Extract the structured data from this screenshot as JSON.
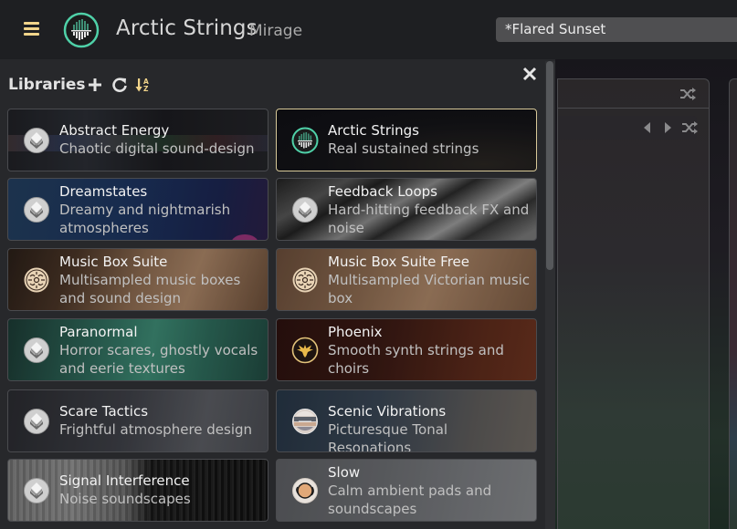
{
  "header": {
    "app_title": "Arctic Strings",
    "app_subtitle": "Mirage",
    "preset_name": "*Flared Sunset",
    "menu_icon": "hamburger-menu-icon",
    "logo_icon": "arctic-strings-logo-icon",
    "accent_color": "#f1d48a"
  },
  "libraries_panel": {
    "title": "Libraries",
    "add_icon": "plus-icon",
    "refresh_icon": "refresh-icon",
    "sort_icon": "sort-az-icon",
    "close_icon": "close-icon",
    "selected_border_color": "#d8c999",
    "items": [
      {
        "name": "Abstract Energy",
        "description": "Chaotic digital sound-design",
        "icon": "diamond-logo-icon",
        "selected": false
      },
      {
        "name": "Arctic Strings",
        "description": "Real sustained strings",
        "icon": "arctic-strings-logo-icon",
        "selected": true
      },
      {
        "name": "Dreamstates",
        "description": "Dreamy and nightmarish atmospheres",
        "icon": "diamond-logo-icon",
        "selected": false
      },
      {
        "name": "Feedback Loops",
        "description": "Hard-hitting feedback FX and noise",
        "icon": "diamond-logo-icon",
        "selected": false
      },
      {
        "name": "Music Box Suite",
        "description": "Multisampled music boxes and sound design",
        "icon": "music-box-logo-icon",
        "selected": false
      },
      {
        "name": "Music Box Suite Free",
        "description": "Multisampled Victorian music box",
        "icon": "music-box-logo-icon",
        "selected": false
      },
      {
        "name": "Paranormal",
        "description": "Horror scares, ghostly vocals and eerie textures",
        "icon": "diamond-logo-icon",
        "selected": false
      },
      {
        "name": "Phoenix",
        "description": "Smooth synth strings and choirs",
        "icon": "phoenix-logo-icon",
        "selected": false
      },
      {
        "name": "Scare Tactics",
        "description": "Frightful atmosphere design",
        "icon": "diamond-logo-icon",
        "selected": false
      },
      {
        "name": "Scenic Vibrations",
        "description": "Picturesque Tonal Resonations",
        "icon": "scenic-logo-icon",
        "selected": false
      },
      {
        "name": "Signal Interference",
        "description": "Noise soundscapes",
        "icon": "diamond-logo-icon",
        "selected": false
      },
      {
        "name": "Slow",
        "description": "Calm ambient pads and soundscapes",
        "icon": "slow-logo-icon",
        "selected": false
      }
    ]
  },
  "right_panel": {
    "shuffle_icon": "shuffle-icon",
    "prev_icon": "arrow-left-icon",
    "next_icon": "arrow-right-icon"
  }
}
